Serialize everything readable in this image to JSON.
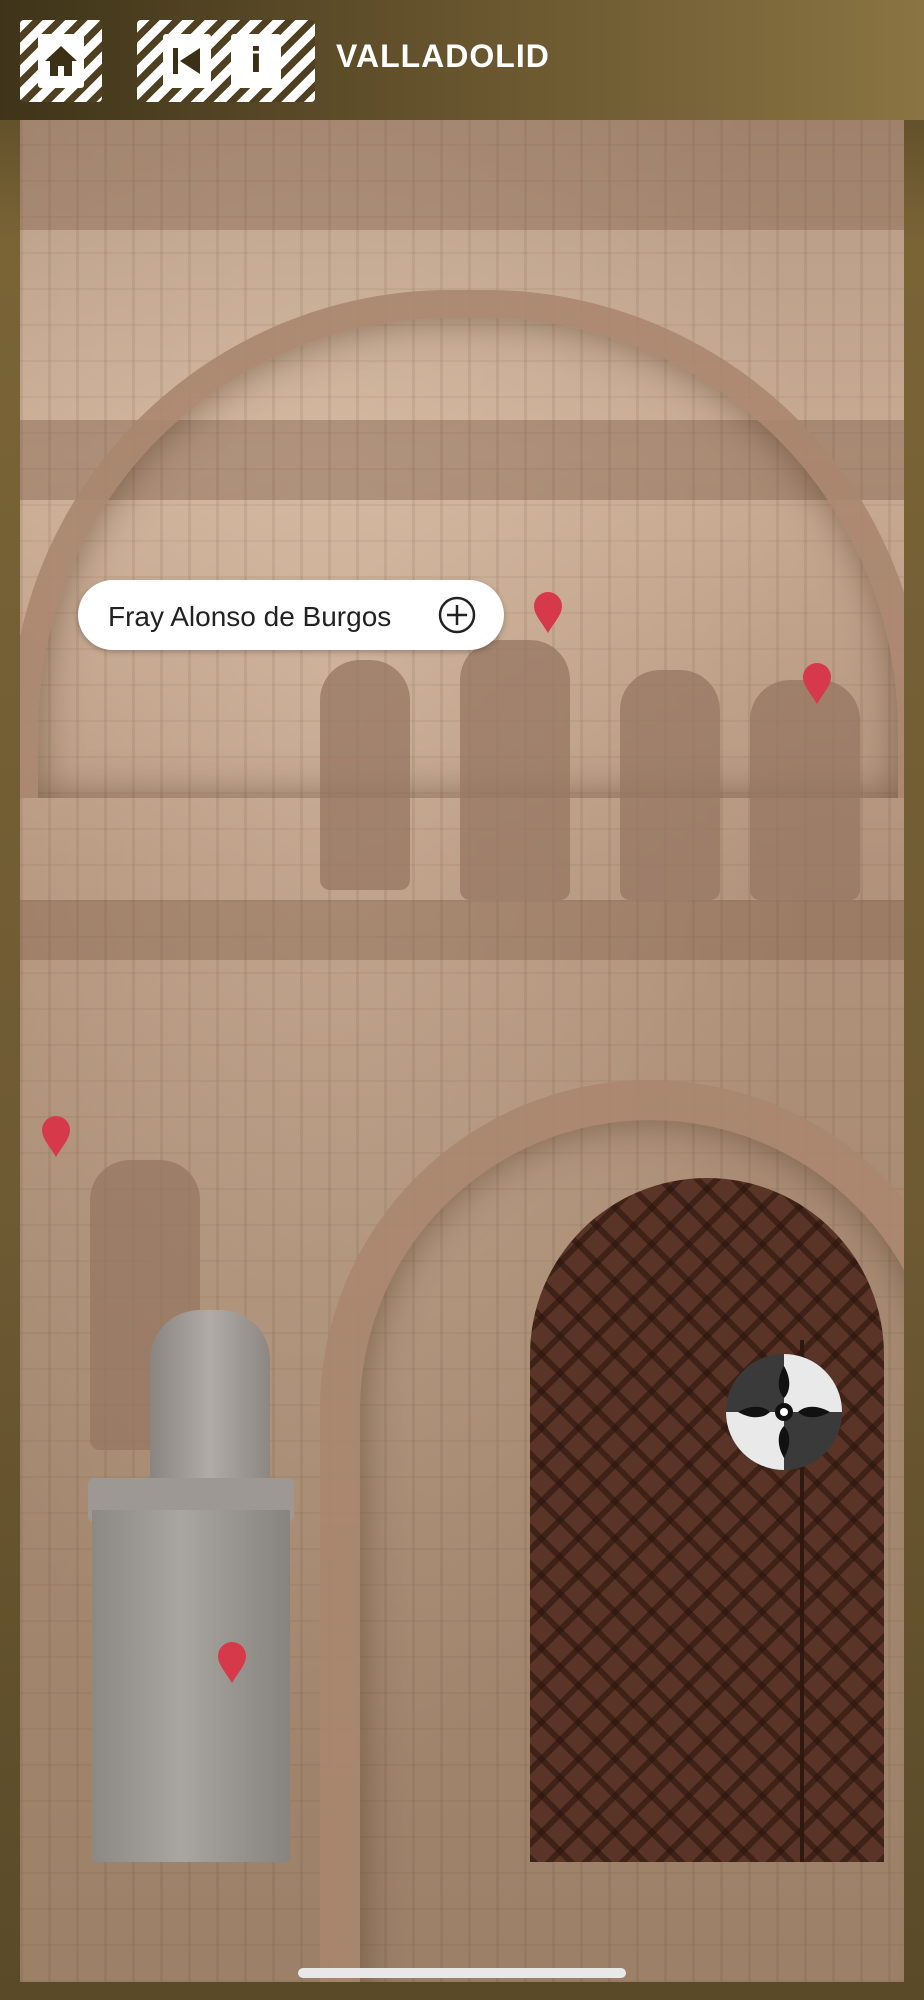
{
  "header": {
    "title": "VALLADOLID",
    "home_icon": "home-icon",
    "back_icon": "back-icon",
    "info_icon": "info-icon",
    "info_glyph": "i"
  },
  "hotspot_label": {
    "text": "Fray Alonso de Burgos",
    "action_icon": "plus-circle-icon"
  },
  "pins": [
    {
      "name": "map-pin-1"
    },
    {
      "name": "map-pin-2"
    },
    {
      "name": "map-pin-3"
    },
    {
      "name": "map-pin-4"
    }
  ],
  "colors": {
    "header_bg": "#6b5830",
    "pin": "#d63a4a",
    "label_bg": "#ffffff"
  }
}
